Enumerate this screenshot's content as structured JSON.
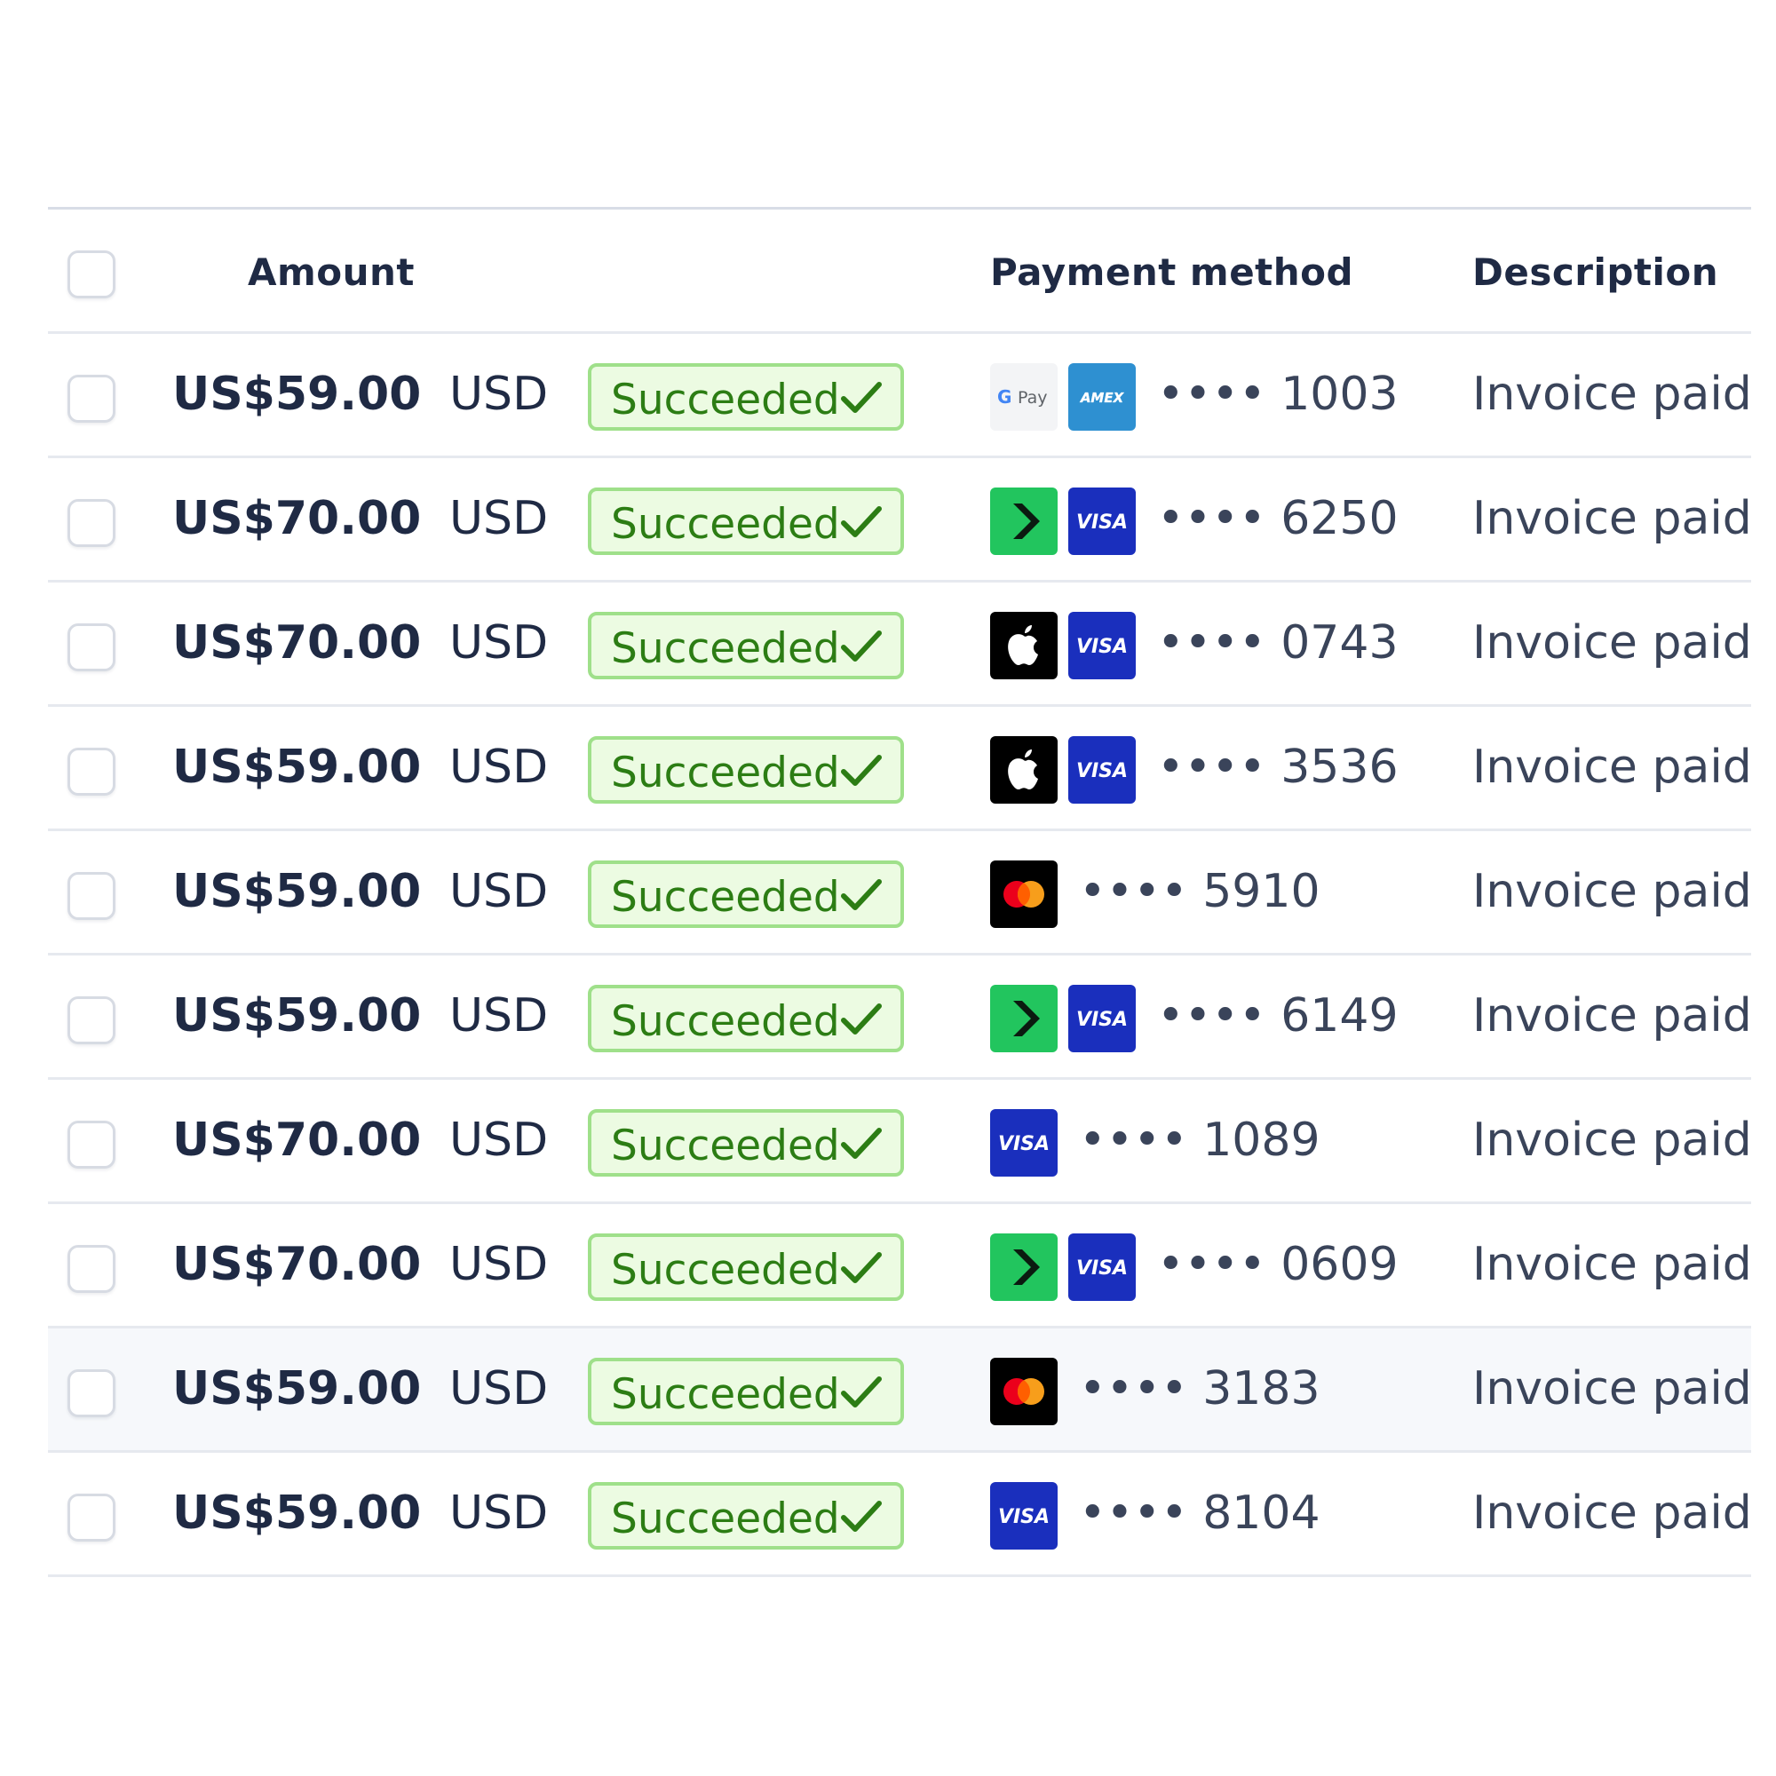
{
  "header": {
    "amount": "Amount",
    "payment_method": "Payment method",
    "description": "Description"
  },
  "colors": {
    "badge_bg": "#ecfbe2",
    "badge_border": "#9fe08a",
    "badge_text": "#2c7d14",
    "visa_blue": "#1a2fbd",
    "link_green": "#22c55e",
    "amex_blue": "#2e90d1"
  },
  "rows": [
    {
      "amount": "US$59.00",
      "currency": "USD",
      "status": "Succeeded",
      "icons": [
        "gpay-icon",
        "amex-icon"
      ],
      "last4": "•••• 1003",
      "description": "Invoice paid"
    },
    {
      "amount": "US$70.00",
      "currency": "USD",
      "status": "Succeeded",
      "icons": [
        "link-icon",
        "visa-icon"
      ],
      "last4": "•••• 6250",
      "description": "Invoice paid"
    },
    {
      "amount": "US$70.00",
      "currency": "USD",
      "status": "Succeeded",
      "icons": [
        "apple-pay-icon",
        "visa-icon"
      ],
      "last4": "•••• 0743",
      "description": "Invoice paid"
    },
    {
      "amount": "US$59.00",
      "currency": "USD",
      "status": "Succeeded",
      "icons": [
        "apple-pay-icon",
        "visa-icon"
      ],
      "last4": "•••• 3536",
      "description": "Invoice paid"
    },
    {
      "amount": "US$59.00",
      "currency": "USD",
      "status": "Succeeded",
      "icons": [
        "mastercard-icon"
      ],
      "last4": "•••• 5910",
      "description": "Invoice paid"
    },
    {
      "amount": "US$59.00",
      "currency": "USD",
      "status": "Succeeded",
      "icons": [
        "link-icon",
        "visa-icon"
      ],
      "last4": "•••• 6149",
      "description": "Invoice paid"
    },
    {
      "amount": "US$70.00",
      "currency": "USD",
      "status": "Succeeded",
      "icons": [
        "visa-icon"
      ],
      "last4": "•••• 1089",
      "description": "Invoice paid"
    },
    {
      "amount": "US$70.00",
      "currency": "USD",
      "status": "Succeeded",
      "icons": [
        "link-icon",
        "visa-icon"
      ],
      "last4": "•••• 0609",
      "description": "Invoice paid"
    },
    {
      "amount": "US$59.00",
      "currency": "USD",
      "status": "Succeeded",
      "icons": [
        "mastercard-icon"
      ],
      "last4": "•••• 3183",
      "description": "Invoice paid",
      "highlighted": true
    },
    {
      "amount": "US$59.00",
      "currency": "USD",
      "status": "Succeeded",
      "icons": [
        "visa-icon"
      ],
      "last4": "•••• 8104",
      "description": "Invoice paid"
    }
  ]
}
